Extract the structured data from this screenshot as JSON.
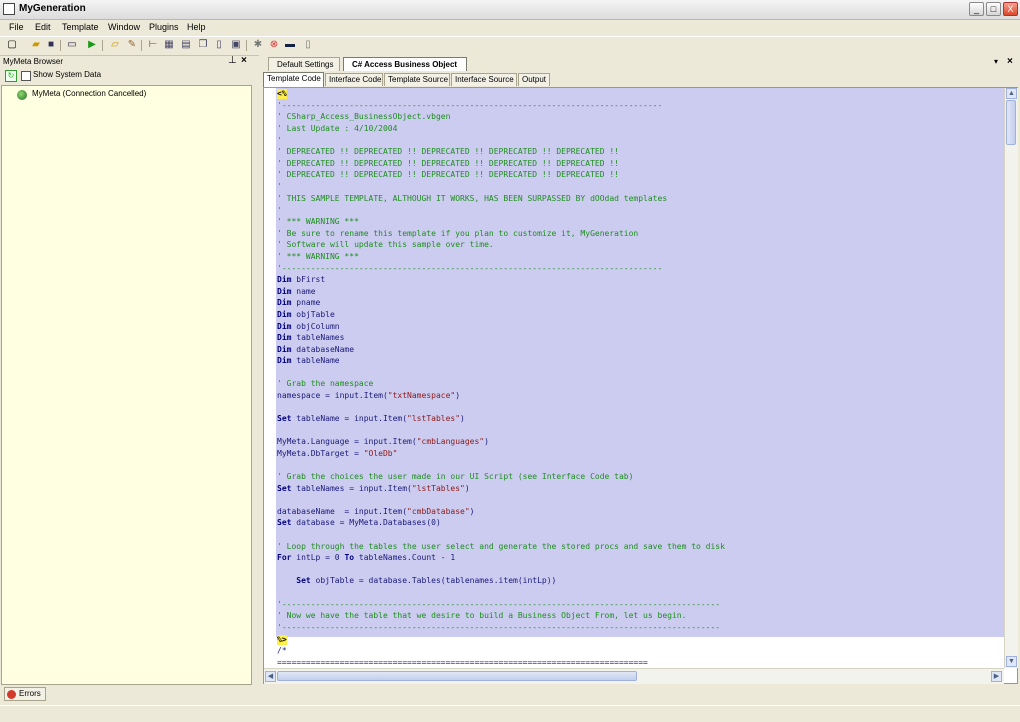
{
  "window": {
    "title": "MyGeneration",
    "min": "_",
    "max": "□",
    "close": "X"
  },
  "menu": [
    "File",
    "Edit",
    "Template",
    "Window",
    "Plugins",
    "Help"
  ],
  "toolbar": {
    "icons": [
      "new-icon",
      "open-icon",
      "save-icon",
      "window-icon",
      "run-icon",
      "open-folder-icon",
      "edit-icon",
      "tree-icon",
      "grid-icon",
      "grid2-icon",
      "copy-icon",
      "doc-icon",
      "code-icon",
      "globe-icon",
      "stop-icon",
      "monitor-icon",
      "lock-icon"
    ]
  },
  "left_panel": {
    "title": "MyMeta Browser",
    "show_system_data": "Show System Data",
    "tree_root": "MyMeta (Connection Cancelled)"
  },
  "doc_tabs": [
    {
      "label": "Default Settings",
      "active": false
    },
    {
      "label": "C# Access Business Object",
      "active": true
    }
  ],
  "sub_tabs": [
    {
      "label": "Template Code",
      "active": true
    },
    {
      "label": "Interface Code",
      "active": false
    },
    {
      "label": "Template Source",
      "active": false
    },
    {
      "label": "Interface Source",
      "active": false
    },
    {
      "label": "Output",
      "active": false
    }
  ],
  "code_lines": [
    "<%",
    "'-------------------------------------------------------------------------------",
    "' CSharp_Access_BusinessObject.vbgen",
    "' Last Update : 4/10/2004",
    "'",
    "' DEPRECATED !! DEPRECATED !! DEPRECATED !! DEPRECATED !! DEPRECATED !!",
    "' DEPRECATED !! DEPRECATED !! DEPRECATED !! DEPRECATED !! DEPRECATED !!",
    "' DEPRECATED !! DEPRECATED !! DEPRECATED !! DEPRECATED !! DEPRECATED !!",
    "'",
    "' THIS SAMPLE TEMPLATE, ALTHOUGH IT WORKS, HAS BEEN SURPASSED BY dOOdad templates",
    "'",
    "' *** WARNING ***",
    "' Be sure to rename this template if you plan to customize it, MyGeneration",
    "' Software will update this sample over time.",
    "' *** WARNING ***",
    "'-------------------------------------------------------------------------------",
    "Dim bFirst",
    "Dim name",
    "Dim pname",
    "Dim objTable",
    "Dim objColumn",
    "Dim tableNames",
    "Dim databaseName",
    "Dim tableName",
    "",
    "' Grab the namespace",
    "namespace = input.Item(\"txtNamespace\")",
    "",
    "Set tableName = input.Item(\"lstTables\")",
    "",
    "MyMeta.Language = input.Item(\"cmbLanguages\")",
    "MyMeta.DbTarget = \"OleDb\"",
    "",
    "' Grab the choices the user made in our UI Script (see Interface Code tab)",
    "Set tableNames = input.Item(\"lstTables\")",
    "",
    "databaseName  = input.Item(\"cmbDatabase\")",
    "Set database = MyMeta.Databases(0)",
    "",
    "' Loop through the tables the user select and generate the stored procs and save them to disk",
    "For intLp = 0 To tableNames.Count - 1",
    "",
    "    Set objTable = database.Tables(tablenames.item(intLp))",
    "",
    "'-------------------------------------------------------------------------------------------",
    "' Now we have the table that we desire to build a Business Object From, let us begin.",
    "'-------------------------------------------------------------------------------------------",
    "%>",
    "/*",
    "============================================================================="
  ],
  "bottom": {
    "errors_label": "Errors"
  },
  "colors": {
    "selection": "#ccccf0",
    "panel_bg": "#ffffe1",
    "chrome": "#ece9d8",
    "comment": "#1d8f1d",
    "keyword": "#00007f",
    "string": "#8b1a1a"
  }
}
